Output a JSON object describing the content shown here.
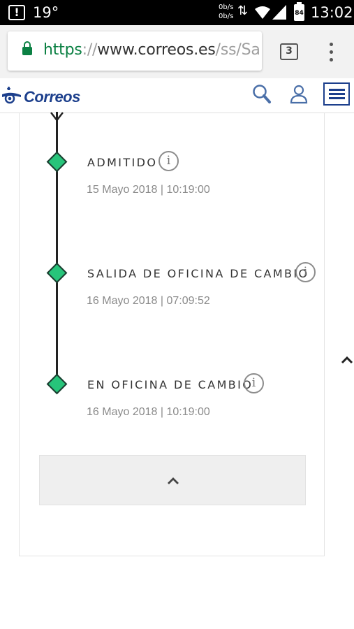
{
  "status_bar": {
    "temperature": "19°",
    "net_up": "0b/s",
    "net_down": "0b/s",
    "battery": "84",
    "time": "13:02"
  },
  "browser": {
    "url_scheme": "https",
    "url_sep": "://",
    "url_host": "www.correos.es",
    "url_path": "/ss/Sa",
    "tab_count": "3"
  },
  "site": {
    "logo_text": "Correos",
    "brand_color": "#1c3f8c"
  },
  "timeline": {
    "events": [
      {
        "title": "ADMITIDO",
        "date": "15 Mayo 2018 | 10:19:00"
      },
      {
        "title": "SALIDA DE OFICINA DE CAMBIO",
        "date": "16 Mayo 2018 | 07:09:52"
      },
      {
        "title": "EN OFICINA DE CAMBIO",
        "date": "16 Mayo 2018 | 10:19:00"
      }
    ],
    "marker_color": "#27c47a",
    "info_glyph": "i"
  }
}
